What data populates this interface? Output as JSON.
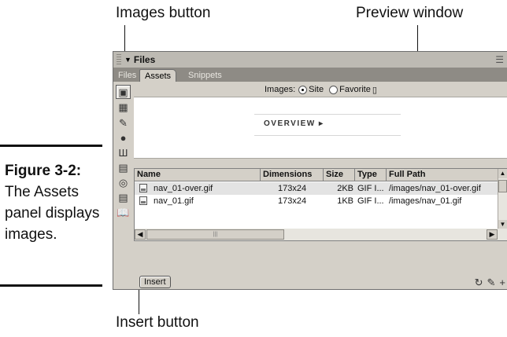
{
  "callouts": {
    "images_button": "Images button",
    "preview_window": "Preview window",
    "insert_button": "Insert button"
  },
  "figure": {
    "number": "Figure 3-2:",
    "caption": "The Assets panel displays images."
  },
  "panel": {
    "title": "Files",
    "tabs": [
      {
        "label": "Files",
        "active": false
      },
      {
        "label": "Assets",
        "active": true
      },
      {
        "label": "Snippets",
        "active": false
      }
    ],
    "category_icons": [
      "images-icon",
      "colors-icon",
      "urls-icon",
      "flash-icon",
      "shockwave-icon",
      "movies-icon",
      "scripts-icon",
      "templates-icon",
      "library-icon"
    ],
    "filter": {
      "label": "Images:",
      "options": [
        {
          "label": "Site",
          "checked": true
        },
        {
          "label": "Favorite",
          "checked": false
        }
      ]
    },
    "preview_text": "OVERVIEW ▸",
    "columns": [
      "Name",
      "Dimensions",
      "Size",
      "Type",
      "Full Path"
    ],
    "rows": [
      {
        "name": "nav_01-over.gif",
        "dimensions": "173x24",
        "size": "2KB",
        "type": "GIF I...",
        "path": "/images/nav_01-over.gif",
        "selected": true
      },
      {
        "name": "nav_01.gif",
        "dimensions": "173x24",
        "size": "1KB",
        "type": "GIF I...",
        "path": "/images/nav_01.gif",
        "selected": false
      }
    ],
    "insert_label": "Insert",
    "bottom_icons": [
      "refresh-icon",
      "edit-icon",
      "add-to-favorites-icon"
    ]
  }
}
